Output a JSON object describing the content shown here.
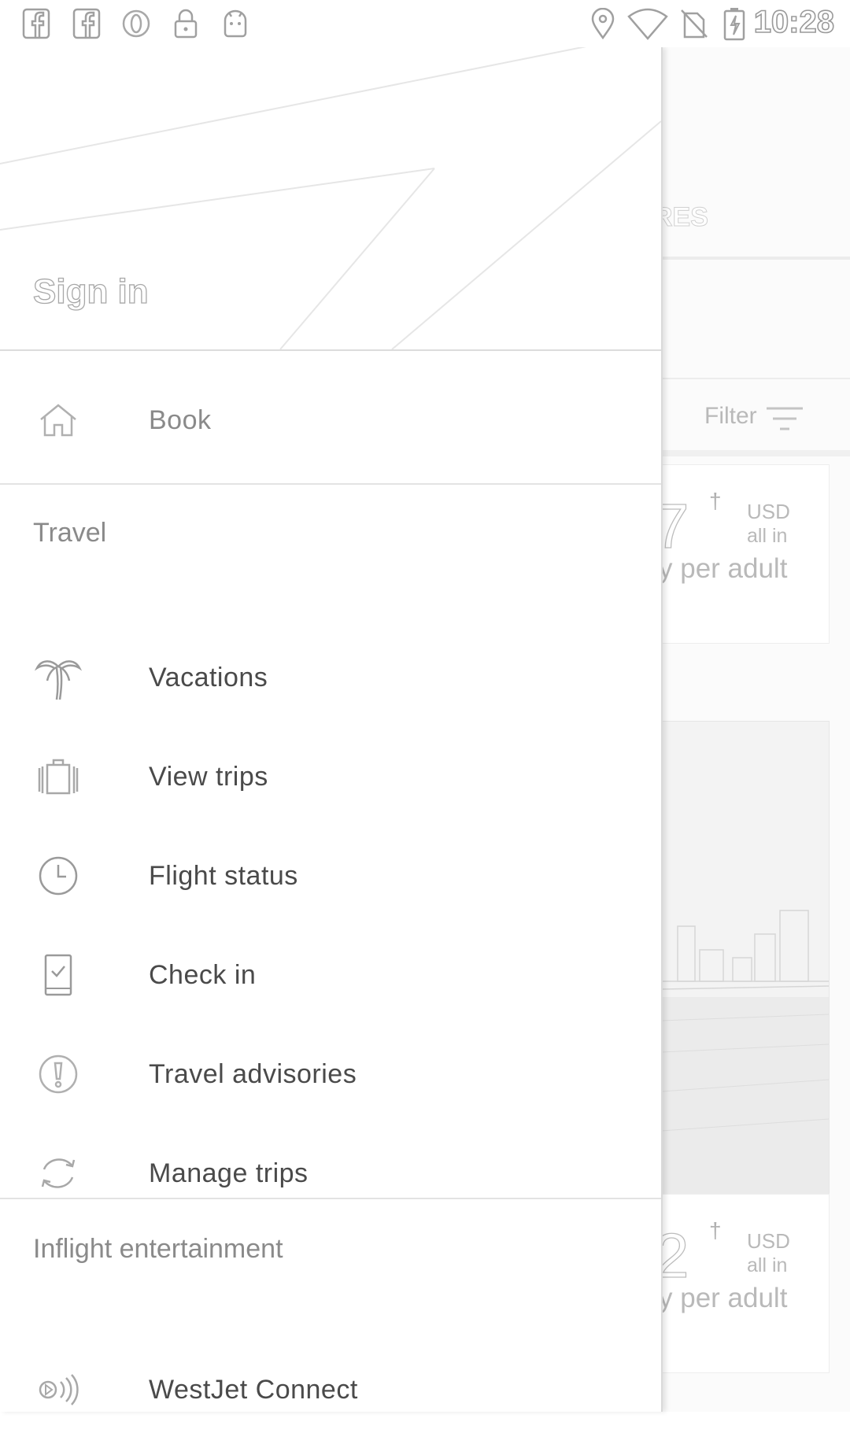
{
  "status_bar": {
    "time": "10:28",
    "left_icons": [
      "facebook-icon",
      "facebook-icon",
      "opera-icon",
      "lock-icon",
      "android-icon"
    ],
    "right_icons": [
      "location-icon",
      "wifi-icon",
      "no-sim-icon",
      "battery-charging-icon"
    ]
  },
  "drawer": {
    "sign_in_label": "Sign in",
    "book": {
      "label": "Book",
      "icon": "home-icon"
    },
    "sections": [
      {
        "title": "Travel",
        "items": [
          {
            "label": "Vacations",
            "icon": "palm-tree-icon"
          },
          {
            "label": "View trips",
            "icon": "luggage-icon"
          },
          {
            "label": "Flight status",
            "icon": "clock-icon"
          },
          {
            "label": "Check in",
            "icon": "phone-check-icon"
          },
          {
            "label": "Travel advisories",
            "icon": "alert-circle-icon"
          },
          {
            "label": "Manage trips",
            "icon": "sync-icon"
          }
        ]
      },
      {
        "title": "Inflight entertainment",
        "items": [
          {
            "label": "WestJet Connect",
            "icon": "broadcast-icon"
          }
        ]
      }
    ]
  },
  "background_screen": {
    "tab_partial_label": "RES",
    "filter_label": "Filter",
    "cards": [
      {
        "price_partial": "7",
        "dagger": "†",
        "currency": "USD",
        "all_in": "all in",
        "per_adult": "y per adult"
      },
      {
        "price_partial": "2",
        "dagger": "†",
        "currency": "USD",
        "all_in": "all in",
        "per_adult": "y per adult"
      }
    ]
  },
  "colors": {
    "drawer_background": "#ffffff",
    "text_primary": "#4a4a4a",
    "text_secondary": "#8a8a8a",
    "divider": "#e3e3e3"
  }
}
